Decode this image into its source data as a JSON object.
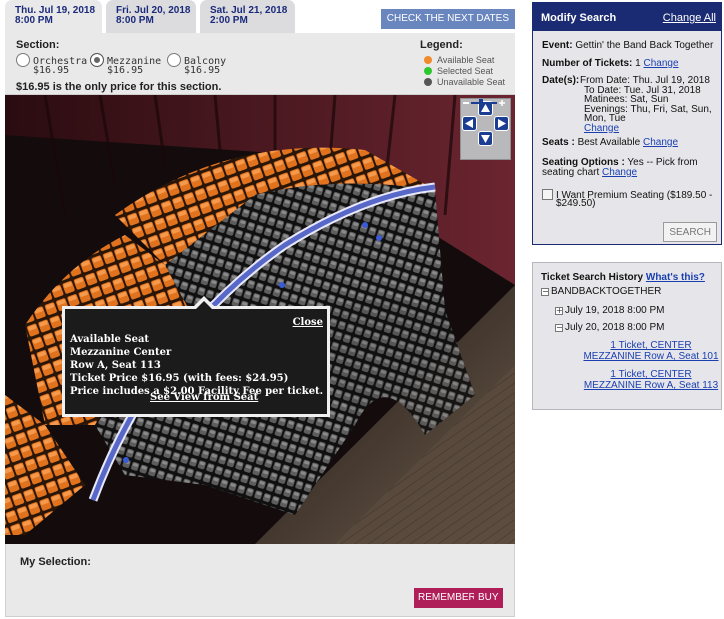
{
  "date_tabs": [
    {
      "date": "Thu. Jul 19, 2018",
      "time": "8:00 PM"
    },
    {
      "date": "Fri. Jul 20, 2018",
      "time": "8:00 PM"
    },
    {
      "date": "Sat. Jul 21, 2018",
      "time": "2:00 PM"
    }
  ],
  "next_dates_label": "CHECK THE NEXT DATES",
  "section": {
    "label": "Section:",
    "options": [
      {
        "name": "Orchestra",
        "price": "$16.95",
        "selected": false
      },
      {
        "name": "Mezzanine",
        "price": "$16.95",
        "selected": true
      },
      {
        "name": "Balcony",
        "price": "$16.95",
        "selected": false
      }
    ],
    "price_note": "$16.95 is the only price for this section."
  },
  "legend": {
    "title": "Legend:",
    "items": [
      {
        "label": "Available Seat",
        "color": "#f08a2a"
      },
      {
        "label": "Selected Seat",
        "color": "#2ec82e"
      },
      {
        "label": "Unavailable Seat",
        "color": "#555555"
      }
    ]
  },
  "seat_popup": {
    "close": "Close",
    "line1": "Available Seat",
    "line2": "Mezzanine Center",
    "line3": "Row A, Seat 113",
    "line4": "Ticket Price $16.95 (with fees: $24.95)",
    "line5": "Price includes a $2.00 Facility Fee per ticket.",
    "view_link": "See View from Seat"
  },
  "selection": {
    "label": "My Selection:",
    "remember": "REMEMBER",
    "buy": "BUY"
  },
  "modify_search": {
    "title": "Modify Search",
    "change_all": "Change All",
    "event_label": "Event:",
    "event_value": "Gettin' the Band Back Together",
    "tickets_label": "Number of Tickets:",
    "tickets_value": "1",
    "change": "Change",
    "dates_label": "Date(s):",
    "dates_lines": [
      "From Date: Thu. Jul 19, 2018",
      "To Date: Tue. Jul 31, 2018",
      "Matinees: Sat, Sun",
      "Evenings: Thu, Fri, Sat, Sun,",
      "Mon, Tue"
    ],
    "seats_label": "Seats :",
    "seats_value": "Best Available",
    "seating_label": "Seating Options :",
    "seating_value": "Yes -- Pick from",
    "seating_value2": "seating chart",
    "premium_line1": "I Want Premium Seating ($189.50 -",
    "premium_line2": "$249.50)",
    "search_button": "SEARCH"
  },
  "history": {
    "title": "Ticket Search History",
    "whats_this": "What's this?",
    "root": "BANDBACKTOGETHER",
    "date1": "July 19, 2018 8:00 PM",
    "date2": "July 20, 2018 8:00 PM",
    "item1_a": "1 Ticket, CENTER",
    "item1_b": "MEZZANINE Row A, Seat 101",
    "item2_a": "1 Ticket, CENTER",
    "item2_b": "MEZZANINE Row A, Seat 113"
  }
}
